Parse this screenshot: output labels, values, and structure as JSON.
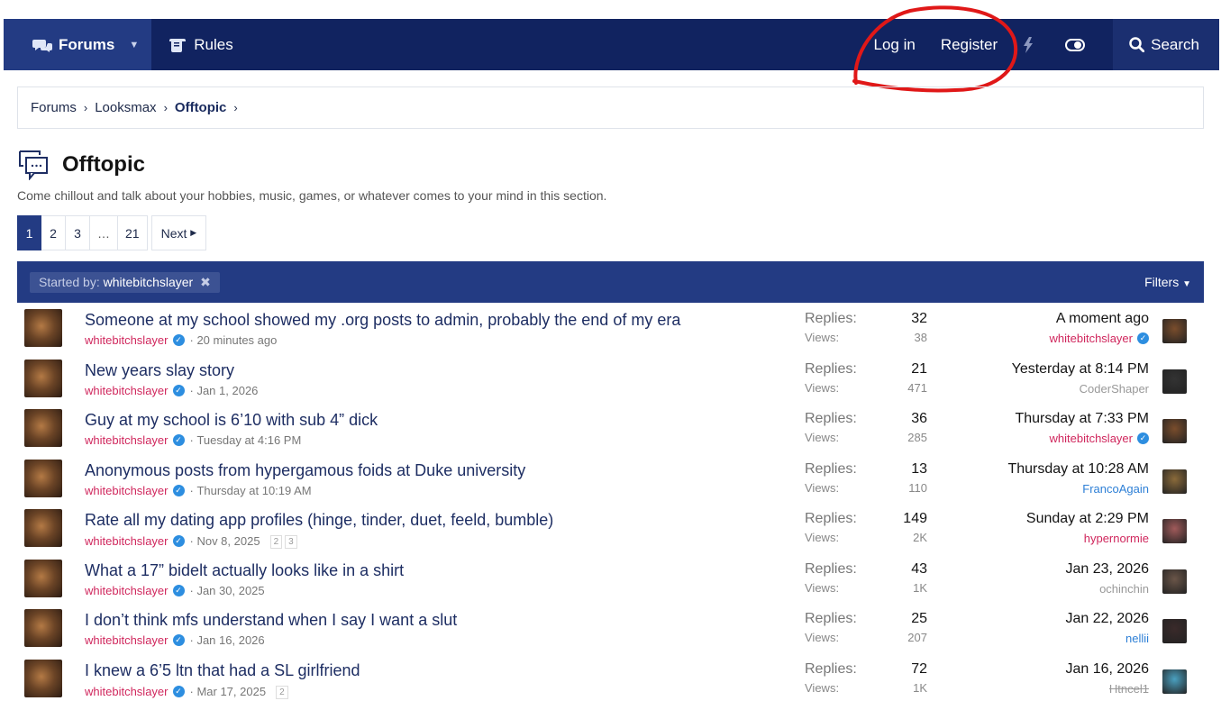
{
  "nav": {
    "forums": "Forums",
    "rules": "Rules",
    "login": "Log in",
    "register": "Register",
    "search": "Search"
  },
  "breadcrumb": [
    "Forums",
    "Looksmax",
    "Offtopic"
  ],
  "page": {
    "title": "Offtopic",
    "description": "Come chillout and talk about your hobbies, music, games, or whatever comes to your mind in this section."
  },
  "pagination": {
    "pages": [
      "1",
      "2",
      "3",
      "…",
      "21"
    ],
    "next": "Next"
  },
  "filter": {
    "label": "Started by:",
    "value": "whitebitchslayer",
    "filters_label": "Filters"
  },
  "stats_labels": {
    "replies": "Replies:",
    "views": "Views:"
  },
  "threads": [
    {
      "title": "Someone at my school showed my .org posts to admin, probably the end of my era",
      "author": "whitebitchslayer",
      "date": "20 minutes ago",
      "pages": [],
      "replies": "32",
      "views": "38",
      "last_time": "A moment ago",
      "last_user": "whitebitchslayer",
      "last_user_style": "pink",
      "last_verified": true,
      "avatar_color": "#7a4d2c"
    },
    {
      "title": "New years slay story",
      "author": "whitebitchslayer",
      "date": "Jan 1, 2026",
      "pages": [],
      "replies": "21",
      "views": "471",
      "last_time": "Yesterday at 8:14 PM",
      "last_user": "CoderShaper",
      "last_user_style": "grey",
      "last_verified": false,
      "avatar_color": "#333333"
    },
    {
      "title": "Guy at my school is 6’10 with sub 4” dick",
      "author": "whitebitchslayer",
      "date": "Tuesday at 4:16 PM",
      "pages": [],
      "replies": "36",
      "views": "285",
      "last_time": "Thursday at 7:33 PM",
      "last_user": "whitebitchslayer",
      "last_user_style": "pink",
      "last_verified": true,
      "avatar_color": "#7a4d2c"
    },
    {
      "title": "Anonymous posts from hypergamous foids at Duke university",
      "author": "whitebitchslayer",
      "date": "Thursday at 10:19 AM",
      "pages": [],
      "replies": "13",
      "views": "110",
      "last_time": "Thursday at 10:28 AM",
      "last_user": "FrancoAgain",
      "last_user_style": "blue",
      "last_verified": false,
      "avatar_color": "#8a6a3a"
    },
    {
      "title": "Rate all my dating app profiles (hinge, tinder, duet, feeld, bumble)",
      "author": "whitebitchslayer",
      "date": "Nov 8, 2025",
      "pages": [
        "2",
        "3"
      ],
      "replies": "149",
      "views": "2K",
      "last_time": "Sunday at 2:29 PM",
      "last_user": "hypernormie",
      "last_user_style": "red",
      "last_verified": false,
      "avatar_color": "#a05a5a"
    },
    {
      "title": "What a 17” bidelt actually looks like in a shirt",
      "author": "whitebitchslayer",
      "date": "Jan 30, 2025",
      "pages": [],
      "replies": "43",
      "views": "1K",
      "last_time": "Jan 23, 2026",
      "last_user": "ochinchin",
      "last_user_style": "grey",
      "last_verified": false,
      "avatar_color": "#6a5548"
    },
    {
      "title": "I don’t think mfs understand when I say I want a slut",
      "author": "whitebitchslayer",
      "date": "Jan 16, 2026",
      "pages": [],
      "replies": "25",
      "views": "207",
      "last_time": "Jan 22, 2026",
      "last_user": "nellii",
      "last_user_style": "blue",
      "last_verified": false,
      "avatar_color": "#3a2a2a"
    },
    {
      "title": "I knew a 6’5 ltn that had a SL girlfriend",
      "author": "whitebitchslayer",
      "date": "Mar 17, 2025",
      "pages": [
        "2"
      ],
      "replies": "72",
      "views": "1K",
      "last_time": "Jan 16, 2026",
      "last_user": "Htncel1",
      "last_user_style": "struck",
      "last_verified": false,
      "avatar_color": "#4aa0c0"
    }
  ]
}
